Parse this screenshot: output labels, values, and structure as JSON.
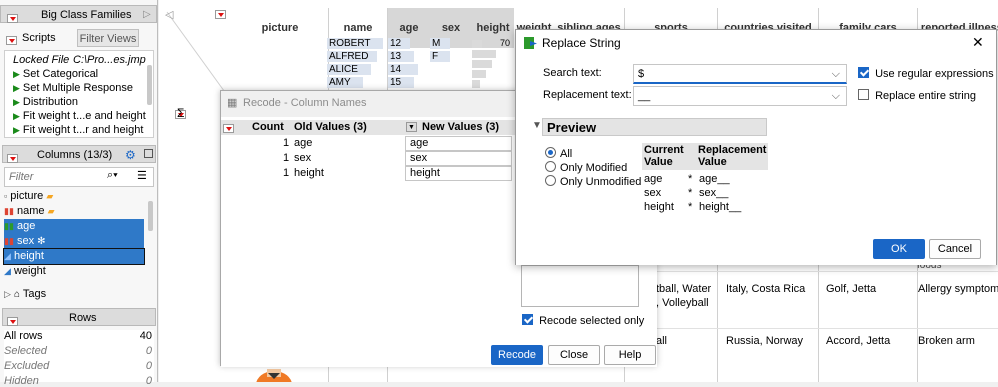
{
  "left": {
    "header_title": "Big Class Families",
    "tabs": [
      "Scripts",
      "Filter Views"
    ],
    "locked_file_label": "Locked File",
    "locked_file_path": "C:\\Pro...es.jmp",
    "scripts": [
      "Set Categorical",
      "Set Multiple Response",
      "Distribution",
      "Fit weight t...e and height",
      "Fit weight t...r and height"
    ],
    "columns_title": "Columns (13/3)",
    "filter_placeholder": "Filter",
    "columns": [
      "picture",
      "name",
      "age",
      "sex",
      "height",
      "weight"
    ],
    "tags_label": "Tags",
    "rows_title": "Rows",
    "rows": [
      {
        "label": "All rows",
        "value": "40"
      },
      {
        "label": "Selected",
        "value": "0"
      },
      {
        "label": "Excluded",
        "value": "0"
      },
      {
        "label": "Hidden",
        "value": "0"
      }
    ]
  },
  "table": {
    "headers": [
      "picture",
      "name",
      "age",
      "sex",
      "height",
      "weight",
      "sibling ages",
      "sports",
      "countries visited",
      "family cars",
      "reported illnesses"
    ],
    "name_cells": [
      "ROBERT",
      "ALFRED",
      "ALICE",
      "AMY"
    ],
    "age_cells": [
      "12",
      "13",
      "14",
      "15"
    ],
    "sex_cells": [
      "M",
      "F"
    ],
    "height_first": "70",
    "row2": {
      "sports1": "tball, Water",
      "sports2": ", Volleyball",
      "countries": "Italy, Costa Rica",
      "cars": "Golf, Jetta",
      "illness": "Allergy symptom"
    },
    "row3": {
      "sports": "all",
      "countries": "Russia, Norway",
      "cars": "Accord, Jetta",
      "illness": "Broken arm"
    },
    "side_text1": "s i",
    "side_text2": "d",
    "side_text3": "foods",
    "sigma": "Σ"
  },
  "recode": {
    "title": "Recode - Column Names",
    "col_count": "Count",
    "col_old": "Old Values (3)",
    "col_new": "New Values (3)",
    "rows": [
      {
        "count": "1",
        "old": "age",
        "new": "age"
      },
      {
        "count": "1",
        "old": "sex",
        "new": "sex"
      },
      {
        "count": "1",
        "old": "height",
        "new": "height"
      }
    ],
    "recode_selected_label": "Recode selected only",
    "buttons": {
      "recode": "Recode",
      "close": "Close",
      "help": "Help"
    }
  },
  "replace": {
    "title": "Replace String",
    "search_label": "Search text:",
    "search_value": "$",
    "replacement_label": "Replacement text:",
    "replacement_value": "__",
    "use_regex_label": "Use regular expressions",
    "use_regex_checked": true,
    "replace_entire_label": "Replace entire string",
    "replace_entire_checked": false,
    "preview_title": "Preview",
    "radio_options": [
      "All",
      "Only Modified",
      "Only Unmodified"
    ],
    "radio_selected": "All",
    "preview_col_current": [
      "Current",
      "Value"
    ],
    "preview_col_replacement": [
      "Replacement",
      "Value"
    ],
    "preview_rows": [
      {
        "current": "age",
        "marker": "*",
        "replacement": "age__"
      },
      {
        "current": "sex",
        "marker": "*",
        "replacement": "sex__"
      },
      {
        "current": "height",
        "marker": "*",
        "replacement": "height__"
      }
    ],
    "ok_label": "OK",
    "cancel_label": "Cancel",
    "close_glyph": "✕"
  },
  "colors": {
    "accent": "#1a66c6",
    "selection": "#2f79c8",
    "red_triangle": "#d11111"
  }
}
